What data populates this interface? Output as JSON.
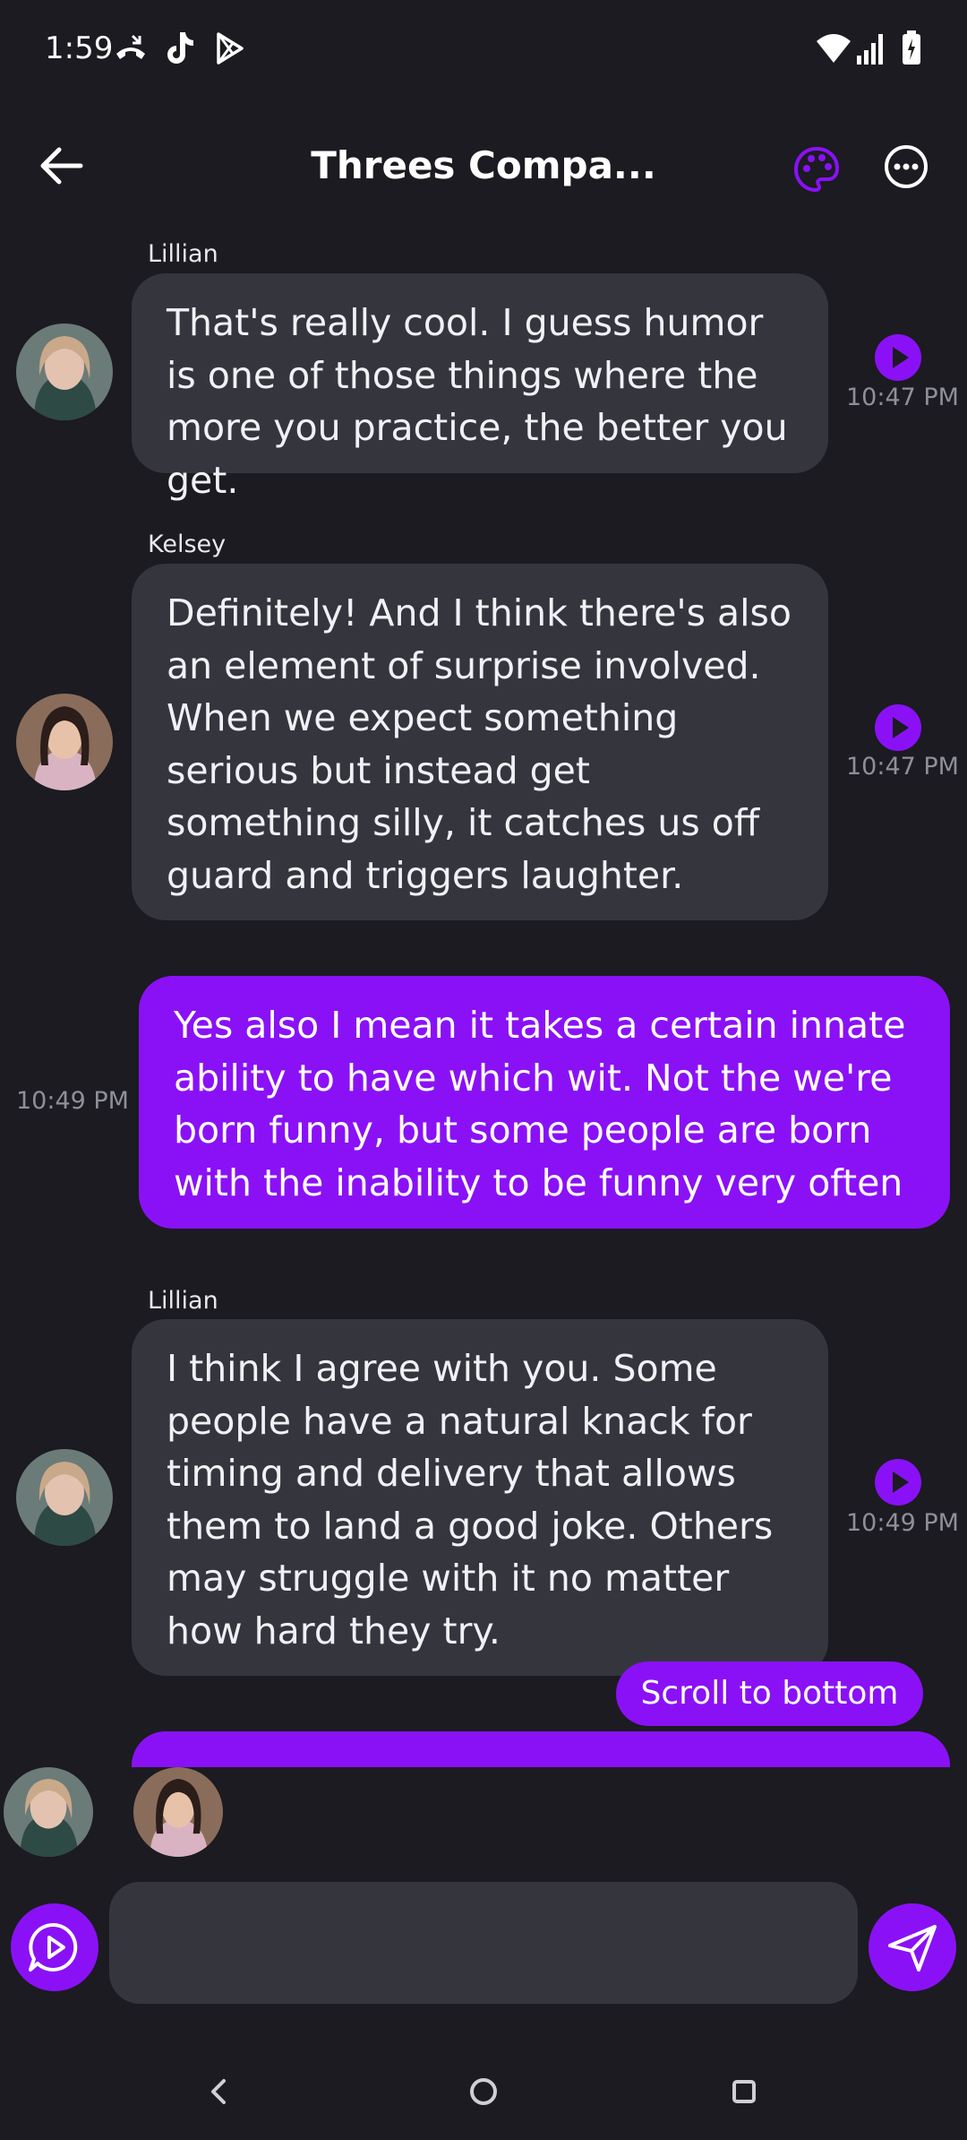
{
  "status_bar": {
    "time": "1:59"
  },
  "header": {
    "title": "Threes Compa..."
  },
  "messages": [
    {
      "sender": "Lillian",
      "text": "That's really cool. I guess humor is one of those things where the more you practice, the better you get.",
      "time": "10:47 PM",
      "from_me": false
    },
    {
      "sender": "Kelsey",
      "text": "Definitely! And I think there's also an element of surprise involved. When we expect something serious but instead get something silly, it catches us off guard and triggers laughter.",
      "time": "10:47 PM",
      "from_me": false
    },
    {
      "sender": "",
      "text": "Yes also I mean it takes a certain innate ability to have which wit. Not the we're born funny, but some people are born with the inability to be funny very often",
      "time": "10:49 PM",
      "from_me": true
    },
    {
      "sender": "Lillian",
      "text": "I think I agree with you. Some people have a natural knack for timing and delivery that allows them to land a good joke. Others may struggle with it no matter how hard they try.",
      "time": "10:49 PM",
      "from_me": false
    }
  ],
  "scroll_button": {
    "label": "Scroll to bottom"
  },
  "colors": {
    "accent": "#8a11f6",
    "background": "#1b1b21",
    "bubble": "#35363d"
  },
  "icons": [
    "back-arrow-icon",
    "palette-icon",
    "more-icon",
    "play-icon",
    "voice-chat-icon",
    "send-icon"
  ]
}
